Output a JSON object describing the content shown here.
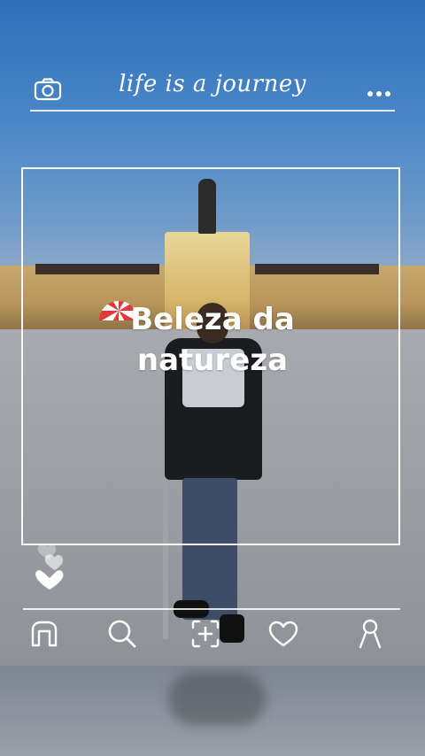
{
  "header": {
    "title": "life is a journey",
    "camera_icon": "camera-icon",
    "menu_icon": "more-dots-icon"
  },
  "post": {
    "caption_line1": "Beleza da",
    "caption_line2": "natureza"
  },
  "reactions": {
    "icon": "heart-icon"
  },
  "nav": {
    "items": [
      {
        "icon": "home-icon"
      },
      {
        "icon": "search-icon"
      },
      {
        "icon": "add-post-icon"
      },
      {
        "icon": "heart-icon"
      },
      {
        "icon": "profile-icon"
      }
    ]
  },
  "colors": {
    "overlay_white": "#ffffff",
    "sky_blue": "#2f6fb9"
  }
}
